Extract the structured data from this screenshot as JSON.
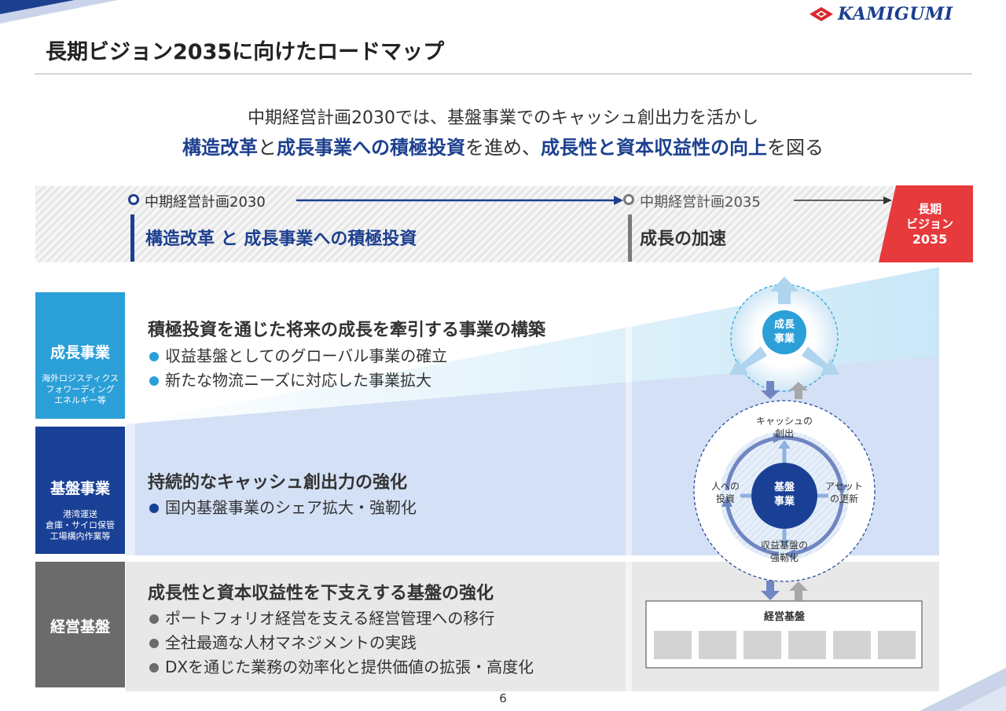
{
  "brand": {
    "logo_text": "KAMIGUMI"
  },
  "page_title": "長期ビジョン2035に向けたロードマップ",
  "lead": {
    "line1": "中期経営計画2030では、基盤事業でのキャッシュ創出力を活かし",
    "line2": [
      {
        "text": "構造改革",
        "highlight": true
      },
      {
        "text": "と",
        "highlight": false
      },
      {
        "text": "成長事業への積極投資",
        "highlight": true
      },
      {
        "text": "を進め、",
        "highlight": false
      },
      {
        "text": "成長性と資本収益性の向上",
        "highlight": true
      },
      {
        "text": "を図る",
        "highlight": false
      }
    ]
  },
  "timeline": {
    "phase1": {
      "label": "中期経営計画2030",
      "theme": "構造改革 と 成長事業への積極投資"
    },
    "phase2": {
      "label": "中期経営計画2035",
      "theme": "成長の加速"
    },
    "vision": {
      "line1": "長期",
      "line2": "ビジョン",
      "line3": "2035"
    }
  },
  "rows": {
    "growth": {
      "label": "成長事業",
      "sub": [
        "海外ロジスティクス",
        "フォワーディング",
        "エネルギー等"
      ],
      "heading": "積極投資を通じた将来の成長を牽引する事業の構築",
      "bullets": [
        "収益基盤としてのグローバル事業の確立",
        "新たな物流ニーズに対応した事業拡大"
      ]
    },
    "base": {
      "label": "基盤事業",
      "sub": [
        "港湾運送",
        "倉庫・サイロ保管",
        "工場構内作業等"
      ],
      "heading": "持続的なキャッシュ創出力の強化",
      "bullets": [
        "国内基盤事業のシェア拡大・強靭化"
      ]
    },
    "mgmt": {
      "label": "経営基盤",
      "heading": "成長性と資本収益性を下支えする基盤の強化",
      "bullets": [
        "ポートフォリオ経営を支える経営管理への移行",
        "全社最適な人材マネジメントの実践",
        "DXを通じた業務の効率化と提供価値の拡張・高度化"
      ]
    }
  },
  "diagram": {
    "growth_circle": [
      "成長",
      "事業"
    ],
    "base_circle": [
      "基盤",
      "事業"
    ],
    "cash": [
      "キャッシュの",
      "創出"
    ],
    "people": [
      "人への",
      "投資"
    ],
    "asset": [
      "アセット",
      "の更新"
    ],
    "revenue": [
      "収益基盤の",
      "強靭化"
    ],
    "foundation": "経営基盤"
  },
  "colors": {
    "navy": "#1c3f8f",
    "growth_blue": "#2b9fd8",
    "base_navy": "#1a4096",
    "mgmt_gray": "#6b6b6b",
    "vision_red": "#e63a3d"
  },
  "page_number": "6"
}
